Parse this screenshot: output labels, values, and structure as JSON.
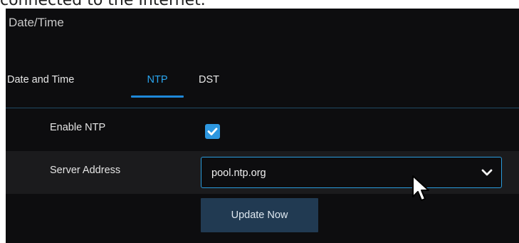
{
  "page": {
    "caption": "connected to the Internet."
  },
  "panel": {
    "title": "Date/Time"
  },
  "tabs": [
    {
      "label": "Date and Time",
      "active": false
    },
    {
      "label": "NTP",
      "active": true
    },
    {
      "label": "DST",
      "active": false
    }
  ],
  "form": {
    "enable_ntp": {
      "label": "Enable NTP",
      "checked": true
    },
    "server_address": {
      "label": "Server Address",
      "value": "pool.ntp.org"
    },
    "update_button": {
      "label": "Update Now"
    }
  },
  "icons": {
    "checkbox": "check-icon",
    "dropdown": "chevron-down-icon",
    "pointer": "mouse-cursor-icon"
  },
  "colors": {
    "panel_background": "#0d0d0f",
    "row_alt_background": "#1b1b1d",
    "accent": "#2aa6f0",
    "checkbox": "#2d97e0",
    "button_background": "#213a52",
    "text": "#e4e4e4"
  }
}
